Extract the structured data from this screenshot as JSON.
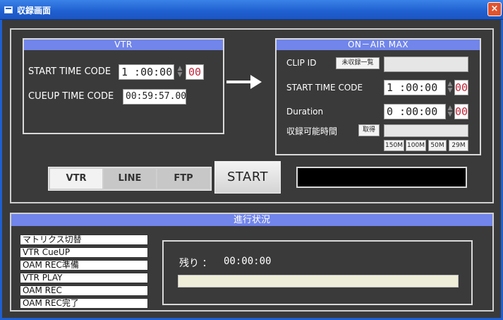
{
  "window": {
    "title": "収録画面",
    "close_glyph": "×"
  },
  "vtr": {
    "header": "VTR",
    "start_tc_label": "START TIME CODE",
    "start_tc_value": "1 :00:00",
    "start_tc_frames": "00",
    "cueup_tc_label": "CUEUP TIME CODE",
    "cueup_tc_value": "00:59:57.00"
  },
  "oam": {
    "header": "ON－AIR  MAX",
    "clip_id_label": "CLIP ID",
    "clip_list_button": "未収録一覧",
    "clip_id_value": "",
    "start_tc_label": "START TIME CODE",
    "start_tc_value": "1 :00:00",
    "start_tc_frames": "00",
    "duration_label": "Duration",
    "duration_value": "0 :00:00",
    "duration_frames": "00",
    "recordable_label": "収録可能時間",
    "get_button": "取得",
    "recordable_value": "",
    "size_buttons": [
      "150M",
      "100M",
      "50M",
      "29M"
    ]
  },
  "modes": {
    "tabs": [
      "VTR",
      "LINE",
      "FTP"
    ],
    "active": "VTR"
  },
  "start_button": "START",
  "status_display": "",
  "progress": {
    "header": "進行状況",
    "steps": [
      "マトリクス切替",
      "VTR  CueUP",
      "OAM  REC準備",
      "VTR  PLAY",
      "OAM REC",
      "OAM REC完了"
    ],
    "remaining_label": "残り  ：",
    "remaining_value": "00:00:00",
    "progress_fraction": 0
  },
  "colors": {
    "accent": "#7185ea",
    "frames_text": "#c0283b",
    "title_bar": "#1f5fd0"
  }
}
